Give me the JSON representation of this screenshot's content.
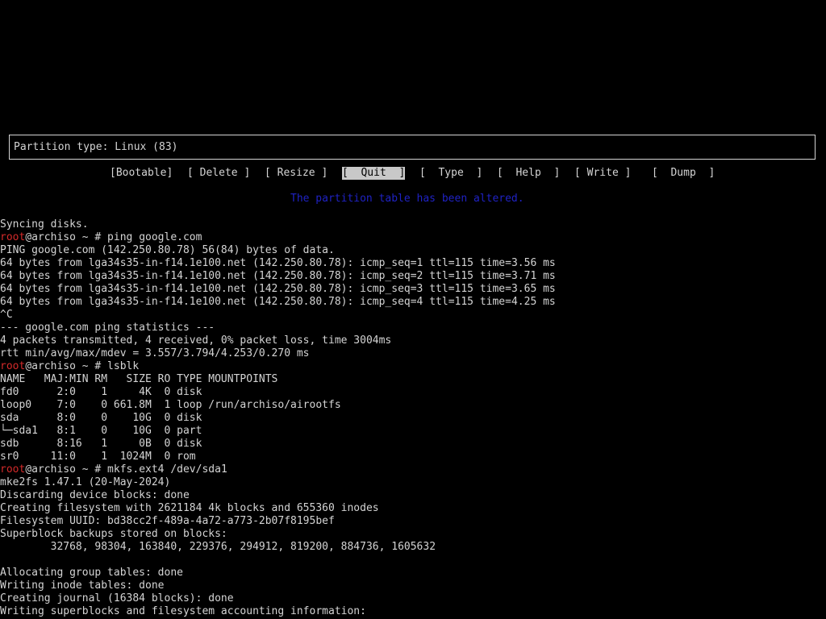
{
  "partition_type": "Partition type: Linux (83)",
  "menu": [
    {
      "label": "[Bootable]",
      "selected": false
    },
    {
      "label": "[ Delete ]",
      "selected": false
    },
    {
      "label": "[ Resize ]",
      "selected": false
    },
    {
      "label": "[  Quit  ]",
      "selected": true
    },
    {
      "label": "[  Type  ]",
      "selected": false
    },
    {
      "label": "[  Help  ]",
      "selected": false
    },
    {
      "label": "[ Write ]",
      "selected": false
    },
    {
      "label": "[  Dump  ]",
      "selected": false
    }
  ],
  "status_message": "The partition table has been altered.",
  "colors": {
    "prompt_user": "#d42a2a",
    "status": "#1f22c4",
    "selected_bg": "#c8c8c8"
  },
  "terminal": {
    "lines": [
      {
        "text": "Syncing disks."
      },
      {
        "user": "root",
        "text": "@archiso ~ # ping google.com"
      },
      {
        "text": "PING google.com (142.250.80.78) 56(84) bytes of data."
      },
      {
        "text": "64 bytes from lga34s35-in-f14.1e100.net (142.250.80.78): icmp_seq=1 ttl=115 time=3.56 ms"
      },
      {
        "text": "64 bytes from lga34s35-in-f14.1e100.net (142.250.80.78): icmp_seq=2 ttl=115 time=3.71 ms"
      },
      {
        "text": "64 bytes from lga34s35-in-f14.1e100.net (142.250.80.78): icmp_seq=3 ttl=115 time=3.65 ms"
      },
      {
        "text": "64 bytes from lga34s35-in-f14.1e100.net (142.250.80.78): icmp_seq=4 ttl=115 time=4.25 ms"
      },
      {
        "text": "^C"
      },
      {
        "text": "--- google.com ping statistics ---"
      },
      {
        "text": "4 packets transmitted, 4 received, 0% packet loss, time 3004ms"
      },
      {
        "text": "rtt min/avg/max/mdev = 3.557/3.794/4.253/0.270 ms"
      },
      {
        "user": "root",
        "text": "@archiso ~ # lsblk"
      },
      {
        "text": "NAME   MAJ:MIN RM   SIZE RO TYPE MOUNTPOINTS"
      },
      {
        "text": "fd0      2:0    1     4K  0 disk"
      },
      {
        "text": "loop0    7:0    0 661.8M  1 loop /run/archiso/airootfs"
      },
      {
        "text": "sda      8:0    0    10G  0 disk"
      },
      {
        "text": "└─sda1   8:1    0    10G  0 part"
      },
      {
        "text": "sdb      8:16   1     0B  0 disk"
      },
      {
        "text": "sr0     11:0    1  1024M  0 rom"
      },
      {
        "user": "root",
        "text": "@archiso ~ # mkfs.ext4 /dev/sda1"
      },
      {
        "text": "mke2fs 1.47.1 (20-May-2024)"
      },
      {
        "text": "Discarding device blocks: done"
      },
      {
        "text": "Creating filesystem with 2621184 4k blocks and 655360 inodes"
      },
      {
        "text": "Filesystem UUID: bd38cc2f-489a-4a72-a773-2b07f8195bef"
      },
      {
        "text": "Superblock backups stored on blocks:"
      },
      {
        "text": "        32768, 98304, 163840, 229376, 294912, 819200, 884736, 1605632"
      },
      {
        "text": ""
      },
      {
        "text": "Allocating group tables: done"
      },
      {
        "text": "Writing inode tables: done"
      },
      {
        "text": "Creating journal (16384 blocks): done"
      },
      {
        "text": "Writing superblocks and filesystem accounting information:"
      }
    ]
  }
}
